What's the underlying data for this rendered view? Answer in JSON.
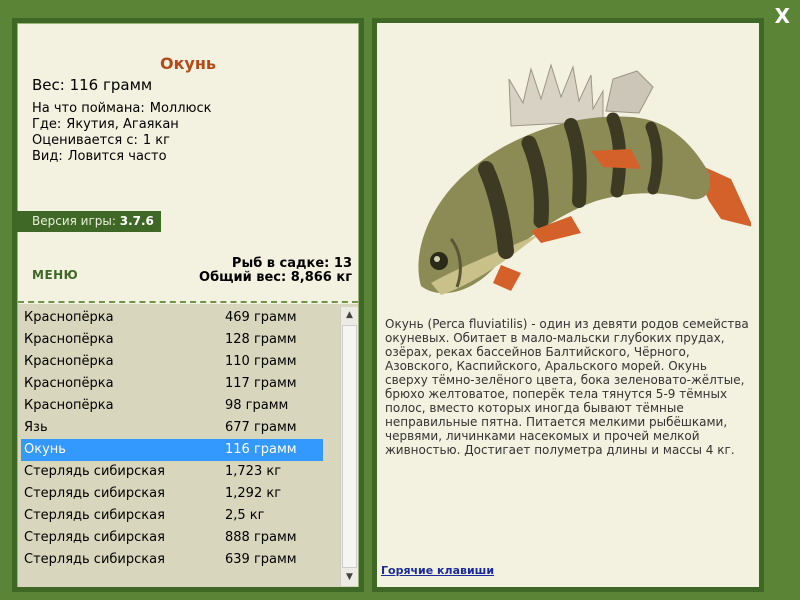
{
  "window": {
    "close_label": "X"
  },
  "fish": {
    "name": "Окунь",
    "weight": "Вес: 116 грамм",
    "info": [
      {
        "label": "На что поймана:",
        "value": "Моллюск"
      },
      {
        "label": "Где:",
        "value": "Якутия, Агаякан"
      },
      {
        "label": "Оценивается с:",
        "value": "1 кг"
      },
      {
        "label": "Вид:",
        "value": "Ловится часто"
      }
    ],
    "description": "Окунь (Perca fluviatilis) - один из девяти родов семейства окуневых. Обитает в мало-мальски глубоких прудах, озёрах, реках бассейнов Балтийского, Чёрного, Азовского, Каспийского, Аральского морей. Окунь сверху тёмно-зелёного цвета, бока зеленовато-жёлтые, брюхо желтоватое, поперёк тела тянутся 5-9 тёмных полос, вместо которых иногда бывают тёмные неправильные пятна. Питается мелкими рыбёшками, червями, личинками насекомых и прочей мелкой живностью. Достигает полуметра длины и массы 4 кг."
  },
  "version": {
    "label": "Версия игры:",
    "value": "3.7.6"
  },
  "menu_label": "МЕНЮ",
  "stats": {
    "keepnet": "Рыб в садке: 13",
    "total_weight": "Общий вес: 8,866 кг"
  },
  "catch_list": [
    {
      "name": "Краснопёрка",
      "weight": "469 грамм"
    },
    {
      "name": "Краснопёрка",
      "weight": "128 грамм"
    },
    {
      "name": "Краснопёрка",
      "weight": "110 грамм"
    },
    {
      "name": "Краснопёрка",
      "weight": "117 грамм"
    },
    {
      "name": "Краснопёрка",
      "weight": "98 грамм"
    },
    {
      "name": "Язь",
      "weight": "677 грамм"
    },
    {
      "name": "Окунь",
      "weight": "116 грамм",
      "selected": true
    },
    {
      "name": "Стерлядь сибирская",
      "weight": "1,723 кг"
    },
    {
      "name": "Стерлядь сибирская",
      "weight": "1,292 кг"
    },
    {
      "name": "Стерлядь сибирская",
      "weight": "2,5 кг"
    },
    {
      "name": "Стерлядь сибирская",
      "weight": "888 грамм"
    },
    {
      "name": "Стерлядь сибирская",
      "weight": "639 грамм"
    }
  ],
  "hotkeys_label": "Горячие клавиши",
  "colors": {
    "frame": "#3f6827",
    "background": "#5b8436",
    "panel": "#f3f1df",
    "title": "#b44a18",
    "selection": "#3399ff",
    "link": "#1a2b99"
  }
}
